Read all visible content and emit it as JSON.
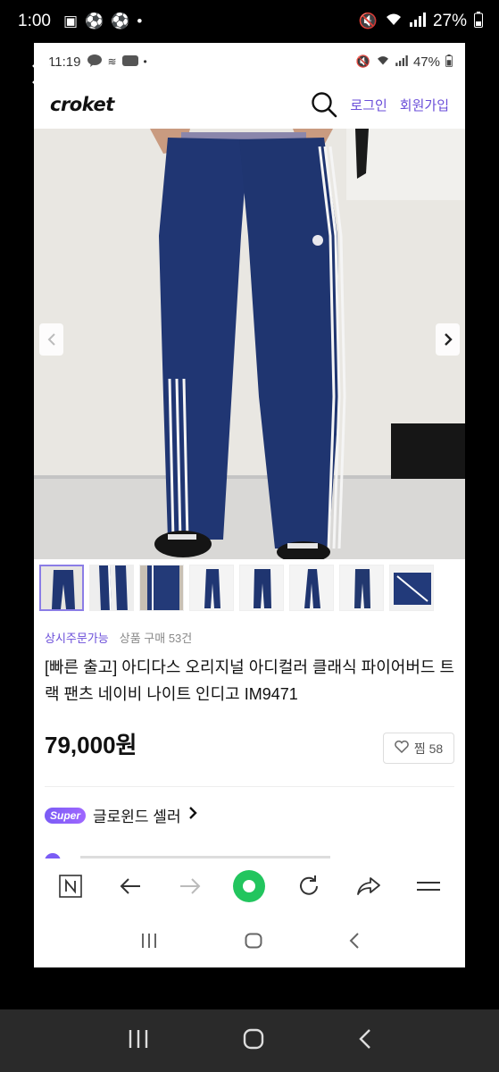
{
  "outer_status": {
    "time": "1:00",
    "battery": "27%"
  },
  "inner_status": {
    "time": "11:19",
    "battery": "47%"
  },
  "header": {
    "logo": "croket",
    "login": "로그인",
    "signup": "회원가입"
  },
  "product": {
    "order_badge": "상시주문가능",
    "sales": "상품 구매 53건",
    "title": "[빠른 출고] 아디다스 오리지널 아디컬러 클래식 파이어버드 트랙 팬츠 네이비 나이트 인디고 IM9471",
    "price": "79,000원",
    "like_label": "찜 58"
  },
  "seller": {
    "badge": "Super",
    "name": "글로윈드 셀러",
    "arrow": "›"
  },
  "colors": {
    "accent": "#6a4dd9",
    "navy": "#1f3570"
  },
  "icons": {
    "toolbar": [
      "naver-icon",
      "back-arrow-icon",
      "forward-arrow-icon",
      "home-circle-icon",
      "refresh-icon",
      "share-icon",
      "menu-icon"
    ],
    "nav": [
      "recent-apps-icon",
      "home-icon",
      "back-icon"
    ]
  }
}
